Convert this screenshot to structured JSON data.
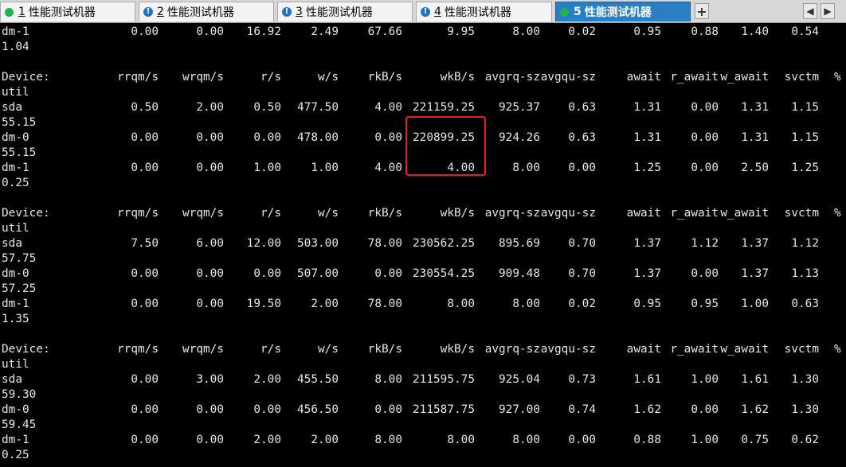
{
  "tabs": [
    {
      "number": "1",
      "label": "性能测试机器",
      "status": "ok"
    },
    {
      "number": "2",
      "label": "性能测试机器",
      "status": "warning"
    },
    {
      "number": "3",
      "label": "性能测试机器",
      "status": "warning"
    },
    {
      "number": "4",
      "label": "性能测试机器",
      "status": "warning"
    },
    {
      "number": "5",
      "label": "性能测试机器",
      "status": "ok",
      "active": true
    }
  ],
  "tabbar": {
    "new_tab_label": "+",
    "prev_label": "◀",
    "next_label": "▶"
  },
  "status_colors": {
    "ok": "#22b24c",
    "warning": "#1f73c9",
    "highlight": "#e02020",
    "active_tab": "#2a7fc4"
  },
  "icons": {
    "ok": "green-dot-icon",
    "warning": "exclamation-icon"
  },
  "terminal": {
    "first_row": {
      "device": "dm-1",
      "values": [
        "0.00",
        "0.00",
        "16.92",
        "2.49",
        "67.66",
        "9.95",
        "8.00",
        "0.02",
        "0.95",
        "0.88",
        "1.40",
        "0.54"
      ],
      "util": "1.04"
    },
    "header": {
      "device": "Device:",
      "columns": [
        "rrqm/s",
        "wrqm/s",
        "r/s",
        "w/s",
        "rkB/s",
        "wkB/s",
        "avgrq-sz",
        "avgqu-sz",
        "await",
        "r_await",
        "w_await",
        "svctm"
      ],
      "util_part1": "%",
      "util_part2": "util"
    },
    "blocks": [
      {
        "rows": [
          {
            "device": "sda",
            "values": [
              "0.50",
              "2.00",
              "0.50",
              "477.50",
              "4.00",
              "221159.25",
              "925.37",
              "0.63",
              "1.31",
              "0.00",
              "1.31",
              "1.15"
            ],
            "util": "55.15"
          },
          {
            "device": "dm-0",
            "values": [
              "0.00",
              "0.00",
              "0.00",
              "478.00",
              "0.00",
              "220899.25",
              "924.26",
              "0.63",
              "1.31",
              "0.00",
              "1.31",
              "1.15"
            ],
            "util": "55.15"
          },
          {
            "device": "dm-1",
            "values": [
              "0.00",
              "0.00",
              "1.00",
              "1.00",
              "4.00",
              "4.00",
              "8.00",
              "0.00",
              "1.25",
              "0.00",
              "2.50",
              "1.25"
            ],
            "util": "0.25"
          }
        ]
      },
      {
        "rows": [
          {
            "device": "sda",
            "values": [
              "7.50",
              "6.00",
              "12.00",
              "503.00",
              "78.00",
              "230562.25",
              "895.69",
              "0.70",
              "1.37",
              "1.12",
              "1.37",
              "1.12"
            ],
            "util": "57.75"
          },
          {
            "device": "dm-0",
            "values": [
              "0.00",
              "0.00",
              "0.00",
              "507.00",
              "0.00",
              "230554.25",
              "909.48",
              "0.70",
              "1.37",
              "0.00",
              "1.37",
              "1.13"
            ],
            "util": "57.25"
          },
          {
            "device": "dm-1",
            "values": [
              "0.00",
              "0.00",
              "19.50",
              "2.00",
              "78.00",
              "8.00",
              "8.00",
              "0.02",
              "0.95",
              "0.95",
              "1.00",
              "0.63"
            ],
            "util": "1.35"
          }
        ]
      },
      {
        "rows": [
          {
            "device": "sda",
            "values": [
              "0.00",
              "3.00",
              "2.00",
              "455.50",
              "8.00",
              "211595.75",
              "925.04",
              "0.73",
              "1.61",
              "1.00",
              "1.61",
              "1.30"
            ],
            "util": "59.30"
          },
          {
            "device": "dm-0",
            "values": [
              "0.00",
              "0.00",
              "0.00",
              "456.50",
              "0.00",
              "211587.75",
              "927.00",
              "0.74",
              "1.62",
              "0.00",
              "1.62",
              "1.30"
            ],
            "util": "59.45"
          },
          {
            "device": "dm-1",
            "values": [
              "0.00",
              "0.00",
              "2.00",
              "2.00",
              "8.00",
              "8.00",
              "8.00",
              "0.00",
              "0.88",
              "1.00",
              "0.75",
              "0.62"
            ],
            "util": "0.25"
          }
        ]
      }
    ]
  }
}
